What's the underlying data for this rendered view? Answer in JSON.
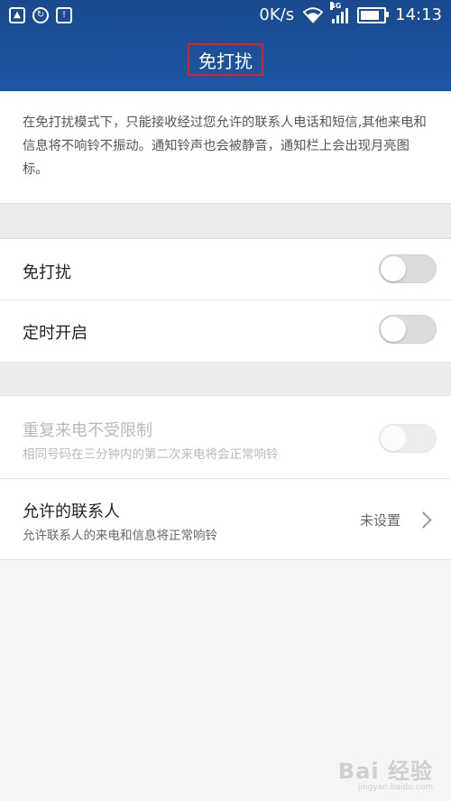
{
  "status_bar": {
    "network_speed": "0K/s",
    "network_type": "4G",
    "time": "14:13",
    "icons": [
      "image-icon",
      "sync-icon",
      "sim-icon",
      "wifi-icon",
      "signal-icon",
      "battery-icon"
    ]
  },
  "header": {
    "title": "免打扰",
    "background": "#1d56a3",
    "highlight_color": "#e02020"
  },
  "description": "在免打扰模式下，只能接收经过您允许的联系人电话和短信,其他来电和信息将不响铃不振动。通知铃声也会被静音，通知栏上会出现月亮图标。",
  "settings": {
    "dnd": {
      "label": "免打扰",
      "enabled": false
    },
    "scheduled": {
      "label": "定时开启",
      "enabled": false
    },
    "repeat_calls": {
      "label": "重复来电不受限制",
      "subtitle": "相同号码在三分钟内的第二次来电将会正常响铃",
      "enabled": false,
      "disabled": true
    },
    "allowed_contacts": {
      "label": "允许的联系人",
      "subtitle": "允许联系人的来电和信息将正常响铃",
      "value": "未设置"
    }
  },
  "watermark": {
    "brand": "Bai 经验",
    "url": "jingyan.baidu.com"
  }
}
